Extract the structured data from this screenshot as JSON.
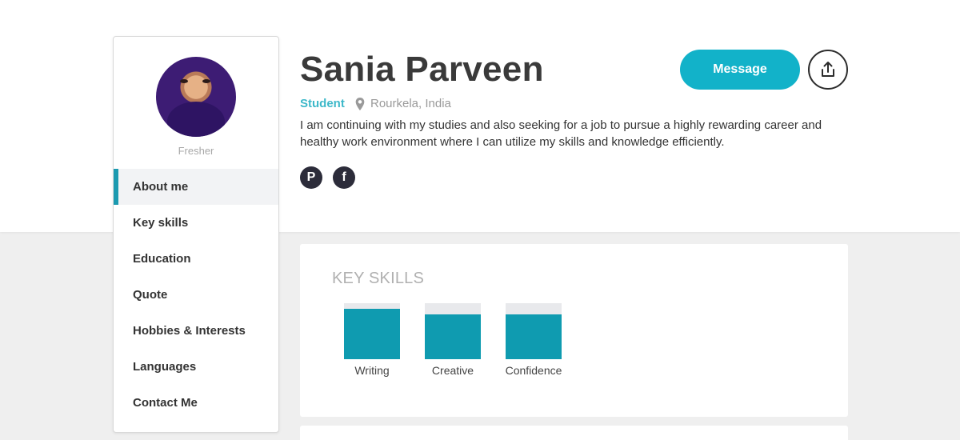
{
  "profile": {
    "name": "Sania Parveen",
    "role": "Student",
    "location": "Rourkela, India",
    "status": "Fresher",
    "bio": "I am continuing with my studies and also seeking for a job to pursue a highly rewarding career and healthy work environment where I can utilize my skills and knowledge efficiently."
  },
  "actions": {
    "message_label": "Message",
    "share_icon": "share-icon"
  },
  "social": {
    "pinterest_glyph": "P",
    "facebook_glyph": "f"
  },
  "nav": {
    "items": [
      {
        "label": "About me"
      },
      {
        "label": "Key skills"
      },
      {
        "label": "Education"
      },
      {
        "label": "Quote"
      },
      {
        "label": "Hobbies & Interests"
      },
      {
        "label": "Languages"
      },
      {
        "label": "Contact Me"
      }
    ],
    "active_index": 0
  },
  "skills": {
    "title": "KEY SKILLS",
    "items": [
      {
        "label": "Writing",
        "level": 0.9
      },
      {
        "label": "Creative",
        "level": 0.8
      },
      {
        "label": "Confidence",
        "level": 0.8
      }
    ]
  },
  "colors": {
    "accent": "#12b2c9",
    "skill_fill": "#0f9bb0",
    "nav_indicator": "#1b9ab0"
  }
}
